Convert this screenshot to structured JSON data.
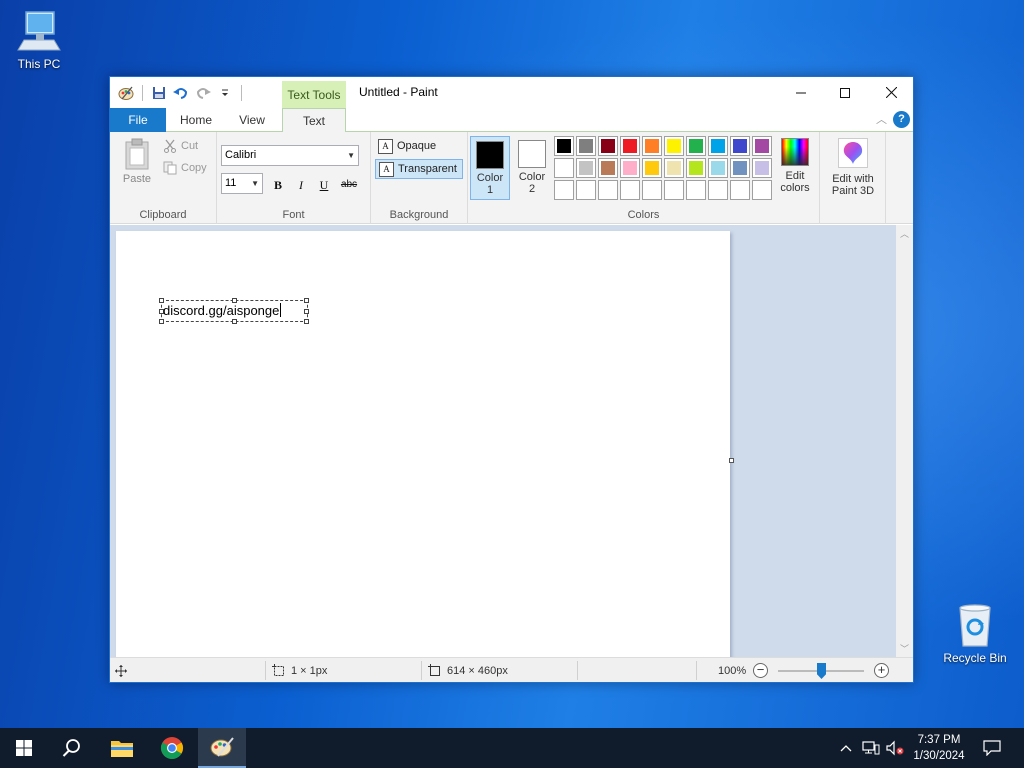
{
  "desktop": {
    "this_pc_label": "This PC",
    "recycle_bin_label": "Recycle Bin"
  },
  "window": {
    "title": "Untitled - Paint",
    "contextual_tab_group": "Text Tools"
  },
  "tabs": {
    "file": "File",
    "home": "Home",
    "view": "View",
    "text": "Text"
  },
  "clipboard": {
    "paste": "Paste",
    "cut": "Cut",
    "copy": "Copy",
    "group_label": "Clipboard"
  },
  "font": {
    "family": "Calibri",
    "size": "11",
    "bold": "B",
    "italic": "I",
    "underline": "U",
    "strikethrough": "abc",
    "group_label": "Font"
  },
  "background": {
    "opaque": "Opaque",
    "transparent": "Transparent",
    "selected": "transparent",
    "group_label": "Background"
  },
  "colors": {
    "color1_label": "Color\n1",
    "color2_label": "Color\n2",
    "color1_value": "#000000",
    "color2_value": "#ffffff",
    "palette_row1": [
      "#000000",
      "#7f7f7f",
      "#880015",
      "#ed1c24",
      "#ff7f27",
      "#fff200",
      "#22b14c",
      "#00a2e8",
      "#3f48cc",
      "#a349a4"
    ],
    "palette_row2": [
      "#ffffff",
      "#c3c3c3",
      "#b97a57",
      "#ffaec9",
      "#ffc90e",
      "#efe4b0",
      "#b5e61d",
      "#99d9ea",
      "#7092be",
      "#c8bfe7"
    ],
    "palette_row3": [
      "",
      "",
      "",
      "",
      "",
      "",
      "",
      "",
      "",
      ""
    ],
    "edit_colors": "Edit\ncolors",
    "group_label": "Colors"
  },
  "paint3d": {
    "label": "Edit with\nPaint 3D"
  },
  "canvas": {
    "text": "discord.gg/aisponge"
  },
  "status": {
    "selection_size": "1 × 1px",
    "canvas_size": "614 × 460px",
    "zoom": "100%",
    "zoom_fraction": 0.5
  },
  "taskbar": {
    "time": "7:37 PM",
    "date": "1/30/2024"
  }
}
